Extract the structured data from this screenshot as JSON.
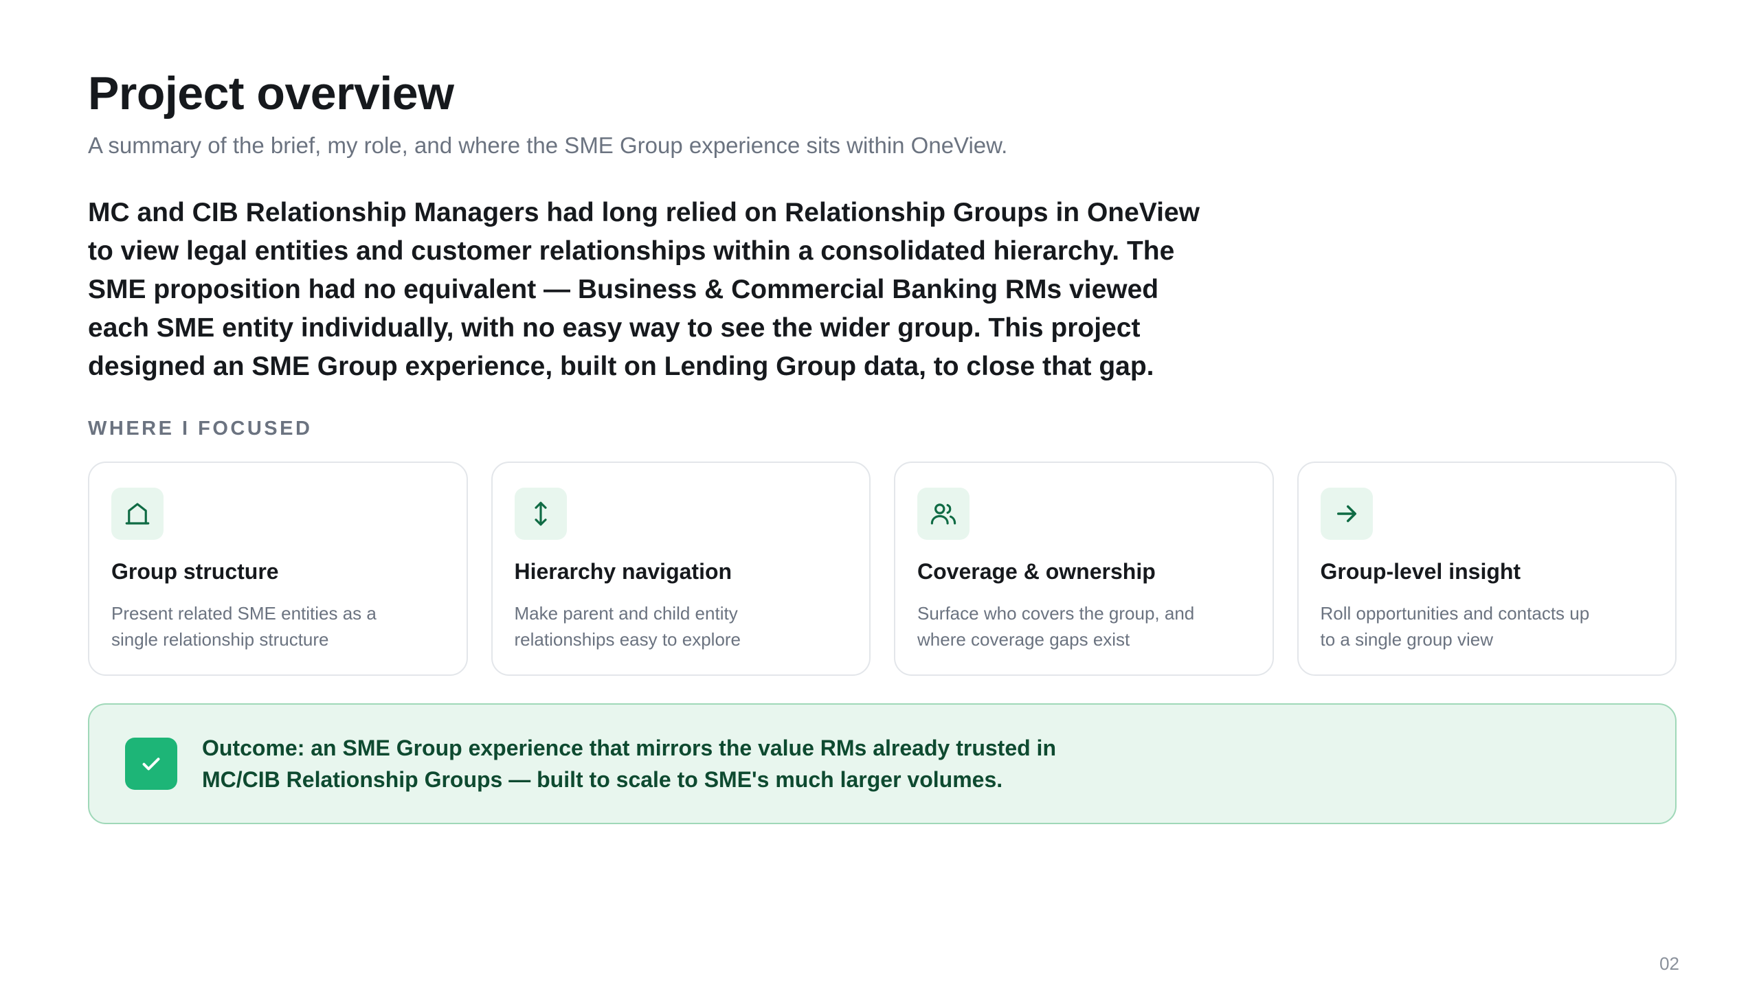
{
  "header": {
    "title": "Project overview",
    "subtitle": "A summary of the brief, my role, and where the SME Group experience sits within OneView."
  },
  "lead": "MC and CIB Relationship Managers had long relied on Relationship Groups in OneView to view legal entities and customer relationships within a consolidated hierarchy. The SME proposition had no equivalent — Business & Commercial Banking RMs viewed each SME entity individually, with no easy way to see the wider group. This project designed an SME Group experience, built on Lending Group data, to close that gap.",
  "focus": {
    "label": "WHERE I FOCUSED",
    "cards": [
      {
        "icon": "building-icon",
        "title": "Group structure",
        "description": "Present related SME entities as a single relationship structure"
      },
      {
        "icon": "arrows-up-down-icon",
        "title": "Hierarchy navigation",
        "description": "Make parent and child entity relationships easy to explore"
      },
      {
        "icon": "users-icon",
        "title": "Coverage & ownership",
        "description": "Surface who covers the group, and where coverage gaps exist"
      },
      {
        "icon": "arrow-right-icon",
        "title": "Group-level insight",
        "description": "Roll opportunities and contacts up to a single group view"
      }
    ]
  },
  "outcome": {
    "icon": "check-icon",
    "text": "Outcome: an SME Group experience that mirrors the value RMs already trusted in MC/CIB Relationship Groups — built to scale to SME's much larger volumes."
  },
  "page_number": "02",
  "colors": {
    "accent": "#1db577",
    "icon_stroke": "#0f6b44",
    "icon_bg": "#e8f6ee",
    "outcome_text": "#0e4a30"
  }
}
